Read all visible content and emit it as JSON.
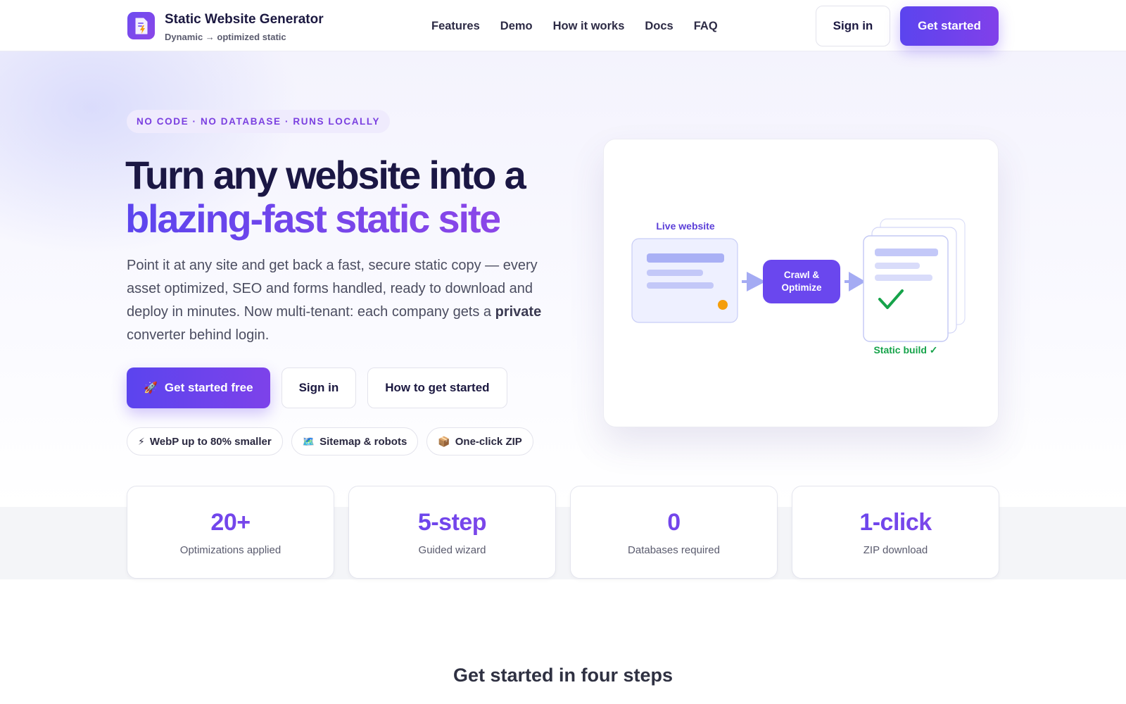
{
  "brand": {
    "title": "Static Website Generator",
    "subtitle": "Dynamic → optimized static",
    "logo_icon": "document-lightning-icon",
    "accent": "#6d4cf0"
  },
  "nav": {
    "links": [
      "Features",
      "Demo",
      "How it works",
      "Docs",
      "FAQ"
    ],
    "signin_label": "Sign in",
    "getstarted_label": "Get started"
  },
  "hero": {
    "pill": "NO CODE · NO DATABASE · RUNS LOCALLY",
    "headline_line1": "Turn any website into a",
    "headline_line2": "blazing-fast static site",
    "lead_part1": "Point it at any site and get back a fast, secure static copy — every asset optimized, SEO and forms handled, ready to download and deploy in minutes. Now multi-tenant: each company gets a ",
    "lead_bold": "private",
    "lead_part2": " converter behind login.",
    "cta_primary": "Get started free",
    "cta_primary_icon": "rocket-icon",
    "cta_signin": "Sign in",
    "cta_howto": "How to get started",
    "chips": [
      {
        "icon": "⚡",
        "icon_name": "lightning-icon",
        "label": "WebP up to 80% smaller"
      },
      {
        "icon": "🗺️",
        "icon_name": "map-icon",
        "label": "Sitemap & robots"
      },
      {
        "icon": "📦",
        "icon_name": "package-icon",
        "label": "One-click ZIP"
      }
    ]
  },
  "illustration": {
    "live_label": "Live website",
    "process_line1": "Crawl &",
    "process_line2": "Optimize",
    "output_label": "Static build ✓",
    "colors": {
      "primary": "#6a47ee",
      "success": "#16a34a",
      "dot": "#f59e0b"
    }
  },
  "stats": [
    {
      "value": "20+",
      "label": "Optimizations applied"
    },
    {
      "value": "5-step",
      "label": "Guided wizard"
    },
    {
      "value": "0",
      "label": "Databases required"
    },
    {
      "value": "1-click",
      "label": "ZIP download"
    }
  ],
  "steps_heading": "Get started in four steps"
}
